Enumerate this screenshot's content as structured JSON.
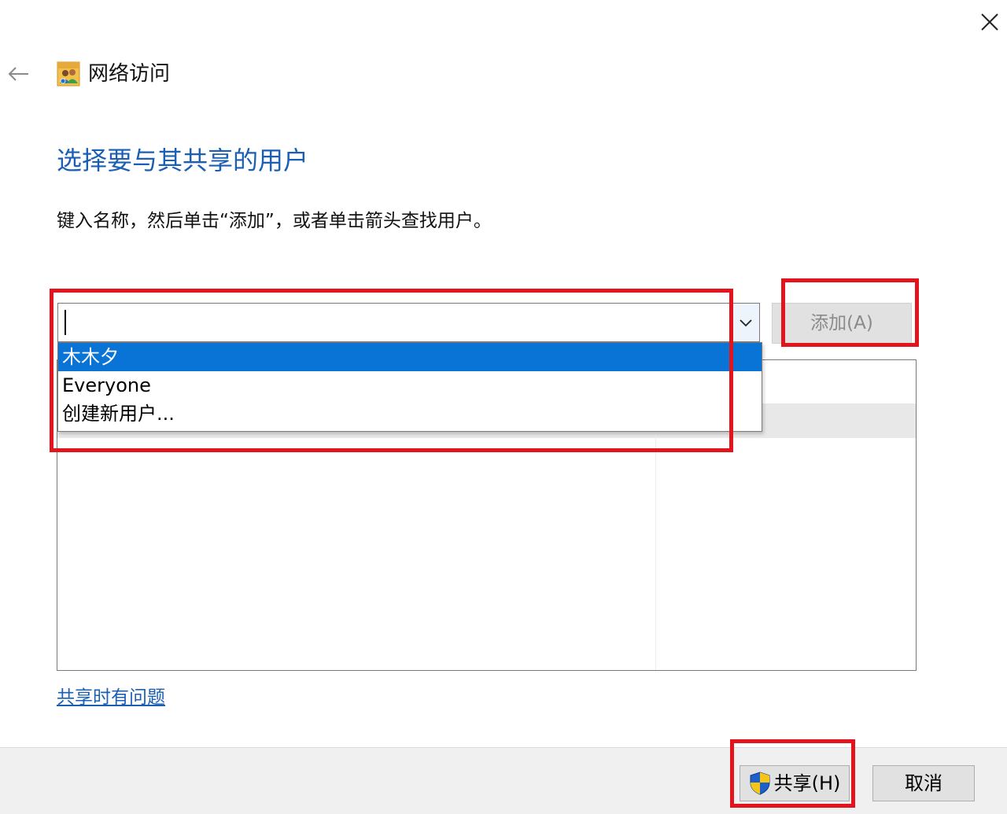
{
  "window": {
    "title": "网络访问",
    "close_icon": "close-icon",
    "back_icon": "back-arrow-icon",
    "app_icon": "network-users-icon"
  },
  "main": {
    "heading": "选择要与其共享的用户",
    "instruction": "键入名称，然后单击“添加”，或者单击箭头查找用户。",
    "combo": {
      "value": "",
      "dropdown_open": true
    },
    "dropdown_items": [
      {
        "label": "木木夕",
        "selected": true
      },
      {
        "label": "Everyone",
        "selected": false
      },
      {
        "label": "创建新用户...",
        "selected": false
      }
    ],
    "add_button": {
      "label": "添加(A)",
      "disabled": true
    },
    "help_link": "共享时有问题"
  },
  "footer": {
    "share_button": {
      "label": "共享(H)",
      "icon": "uac-shield-icon"
    },
    "cancel_button": {
      "label": "取消"
    }
  },
  "colors": {
    "heading_blue": "#1a5fb4",
    "selection_blue": "#0a74d6",
    "highlight_red": "#e3141c"
  }
}
